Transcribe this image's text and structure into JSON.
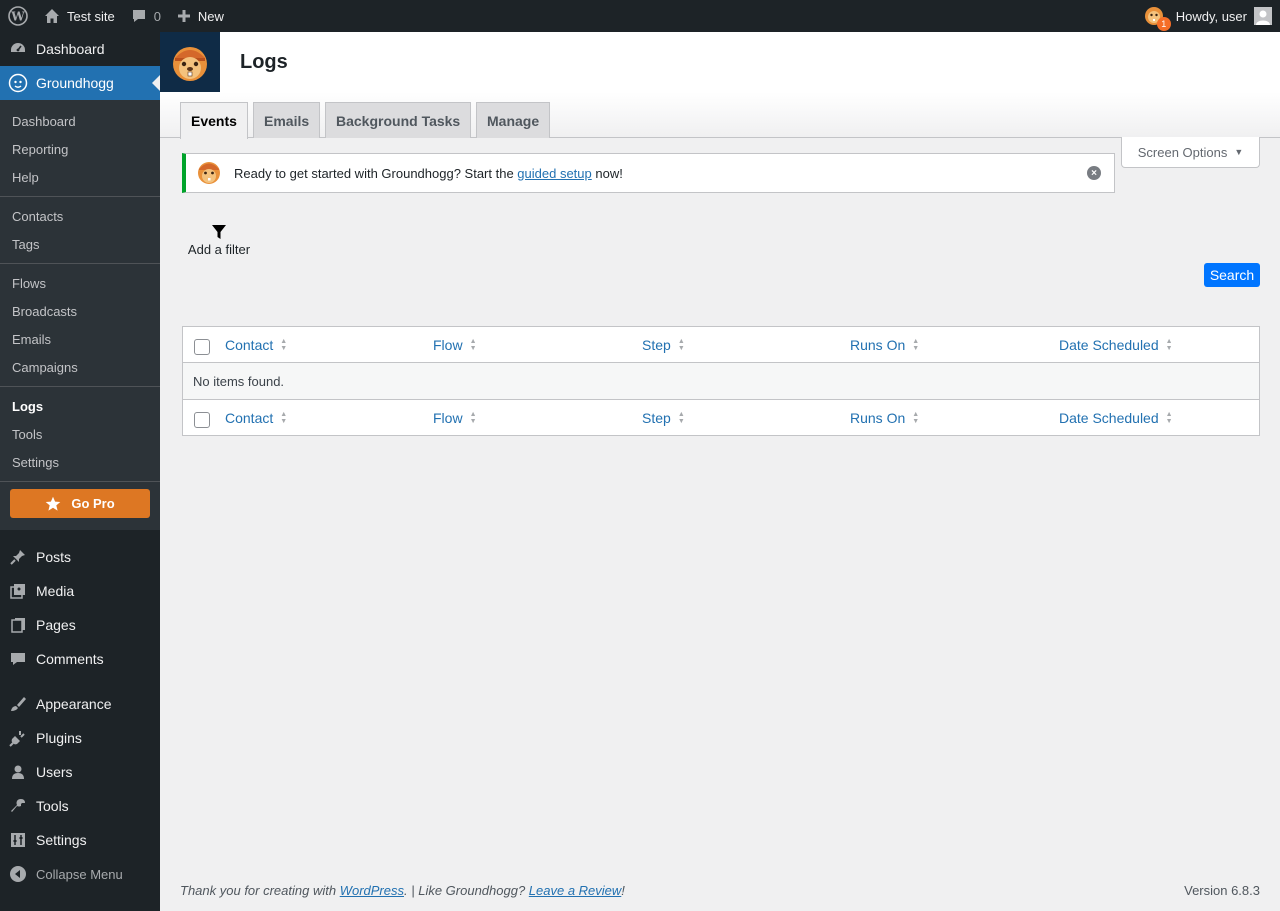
{
  "adminbar": {
    "site_name": "Test site",
    "comments_count": "0",
    "new_label": "New",
    "notification_count": "1",
    "howdy": "Howdy, user"
  },
  "sidebar": {
    "top_items": [
      {
        "label": "Dashboard",
        "icon": "dashboard-icon"
      },
      {
        "label": "Groundhogg",
        "icon": "groundhogg-icon"
      }
    ],
    "submenu_groups": [
      [
        "Dashboard",
        "Reporting",
        "Help"
      ],
      [
        "Contacts",
        "Tags"
      ],
      [
        "Flows",
        "Broadcasts",
        "Emails",
        "Campaigns"
      ],
      [
        "Logs",
        "Tools",
        "Settings"
      ]
    ],
    "go_pro": "Go Pro",
    "bottom_items": [
      {
        "label": "Posts",
        "icon": "pin-icon"
      },
      {
        "label": "Media",
        "icon": "media-icon"
      },
      {
        "label": "Pages",
        "icon": "pages-icon"
      },
      {
        "label": "Comments",
        "icon": "comment-icon"
      },
      {
        "label": "Appearance",
        "icon": "brush-icon"
      },
      {
        "label": "Plugins",
        "icon": "plug-icon"
      },
      {
        "label": "Users",
        "icon": "user-icon"
      },
      {
        "label": "Tools",
        "icon": "wrench-icon"
      },
      {
        "label": "Settings",
        "icon": "settings-icon"
      }
    ],
    "collapse": "Collapse Menu"
  },
  "page": {
    "title": "Logs",
    "tabs": [
      "Events",
      "Emails",
      "Background Tasks",
      "Manage"
    ],
    "screen_options": "Screen Options"
  },
  "notice": {
    "before": "Ready to get started with Groundhogg? Start the ",
    "link": "guided setup",
    "after": " now!"
  },
  "filter": {
    "label": "Add a filter"
  },
  "search_button": "Search",
  "table": {
    "columns": [
      "Contact",
      "Flow",
      "Step",
      "Runs On",
      "Date Scheduled"
    ],
    "empty_message": "No items found."
  },
  "footer": {
    "thanks_before": "Thank you for creating with ",
    "wordpress_link": "WordPress",
    "thanks_middle": ". | Like Groundhogg? ",
    "review_link": "Leave a Review",
    "thanks_after": "!",
    "version": "Version 6.8.3"
  },
  "colors": {
    "admin_dark": "#1d2327",
    "primary_blue": "#2271b1",
    "go_pro_orange": "#dd7723",
    "search_blue": "#0075ff",
    "notice_green": "#00a32a"
  }
}
